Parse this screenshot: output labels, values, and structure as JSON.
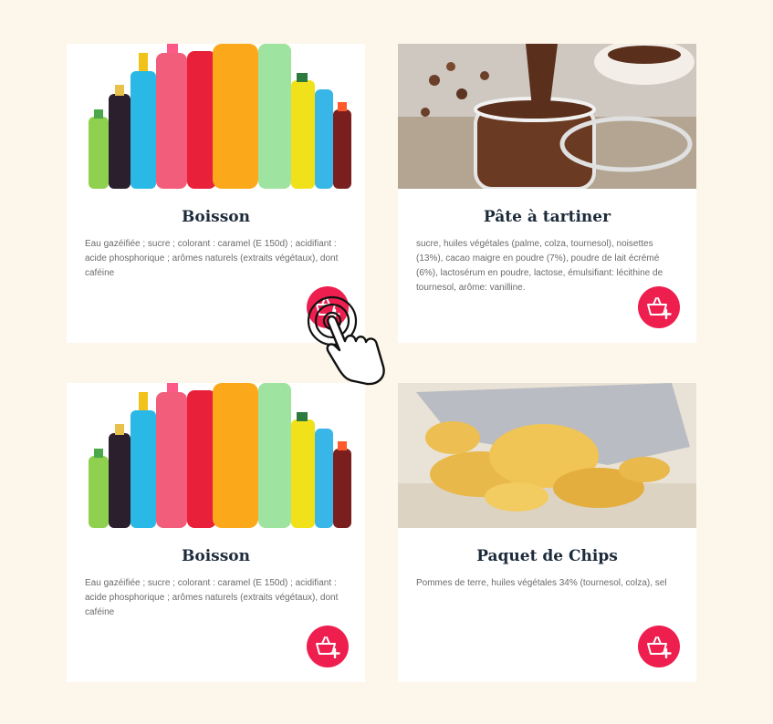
{
  "products": [
    {
      "title": "Boisson",
      "description": "Eau gazéifiée ; sucre ; colorant : caramel (E 150d) ; acidifiant : acide phosphorique ; arômes naturels (extraits végétaux), dont caféine",
      "image": "soda-bottles",
      "button_icon": "add-to-basket-icon"
    },
    {
      "title": "Pâte à tartiner",
      "description": "sucre, huiles végétales (palme, colza, tournesol), noisettes (13%), cacao maigre en poudre (7%), poudre de lait écrémé (6%), lactosérum en poudre, lactose, émulsifiant: lécithine de tournesol, arôme: vanilline.",
      "image": "chocolate-spread-jar",
      "button_icon": "add-to-basket-icon"
    },
    {
      "title": "Boisson",
      "description": "Eau gazéifiée ; sucre ; colorant : caramel (E 150d) ; acidifiant : acide phosphorique ; arômes naturels (extraits végétaux), dont caféine",
      "image": "soda-bottles",
      "button_icon": "add-to-basket-icon"
    },
    {
      "title": "Paquet de Chips",
      "description": "Pommes de terre, huiles végétales 34% (tournesol, colza), sel",
      "image": "potato-chips",
      "button_icon": "add-to-basket-icon"
    }
  ],
  "colors": {
    "background": "#fdf6ea",
    "card": "#ffffff",
    "title": "#1c2a3a",
    "accent": "#ee1f4f"
  },
  "overlay": {
    "icon": "tap-hand-icon"
  }
}
